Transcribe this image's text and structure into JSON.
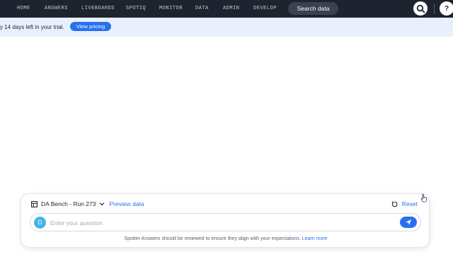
{
  "nav": {
    "items": [
      "HOME",
      "ANSWERS",
      "LIVEBOARDS",
      "SPOTIQ",
      "MONITOR",
      "DATA",
      "ADMIN",
      "DEVELOP"
    ],
    "search_label": "Search data",
    "help_label": "?"
  },
  "trial": {
    "text": "y 14 days left in your trial.",
    "button": "View pricing"
  },
  "spotter": {
    "datasource": "DA Bench - Run 273",
    "preview": "Preview data",
    "reset": "Reset",
    "avatar_initial": "D",
    "placeholder": "Enter your question",
    "disclaimer": "Spotter Answers should be reviewed to ensure they align with your expectations.",
    "learn_more": "Learn more"
  },
  "colors": {
    "nav_bg": "#1d232f",
    "accent": "#2770ef",
    "trial_bg": "#e8f0fe",
    "avatar": "#46b4e6"
  }
}
